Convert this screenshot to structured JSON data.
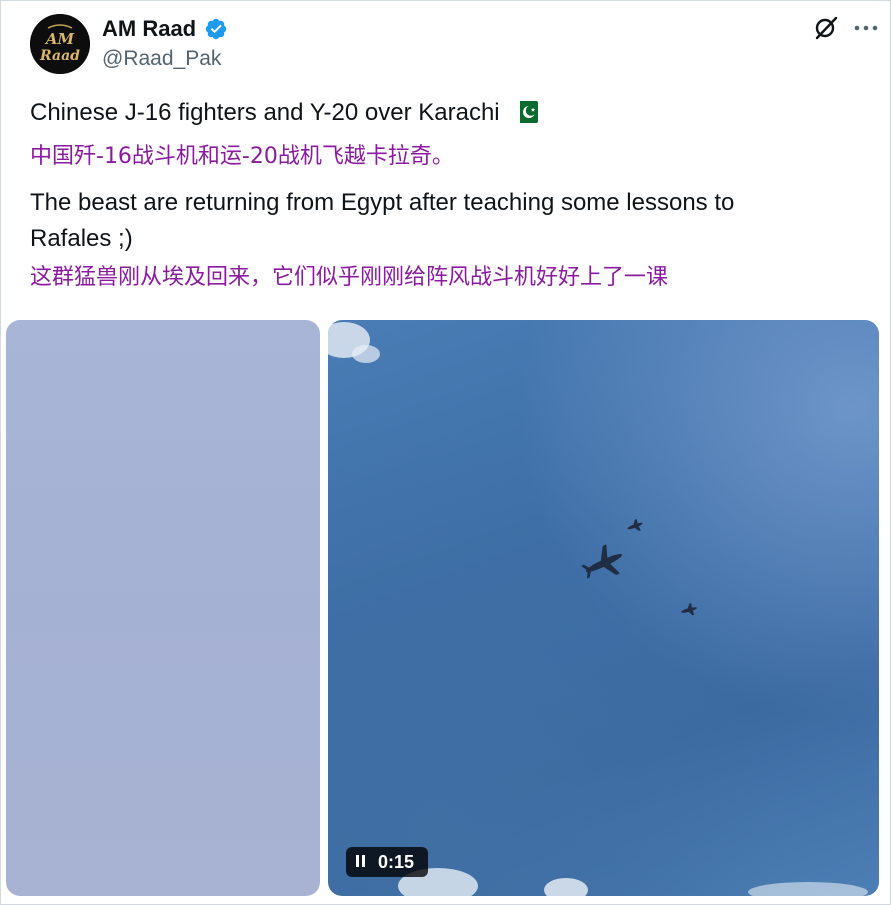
{
  "post": {
    "author": {
      "display_name": "AM Raad",
      "handle": "@Raad_Pak",
      "verified": true,
      "avatar_text": [
        "AM",
        "Raad"
      ]
    },
    "icons": {
      "grok": "grok-icon",
      "more": "more-icon",
      "verified": "verified-badge-icon",
      "flag": "pakistan-flag-icon",
      "pause": "pause-icon"
    },
    "text": {
      "line1": "Chinese J-16 fighters and Y-20 over Karachi",
      "line1_zh": "中国歼-16战斗机和运-20战机飞越卡拉奇。",
      "line2a": "The beast are returning from Egypt after teaching some lessons to",
      "line2b": "Rafales ;)",
      "line2_zh": "这群猛兽刚从埃及回来，它们似乎刚刚给阵风战斗机好好上了一课"
    },
    "media": {
      "video_duration": "0:15"
    }
  },
  "colors": {
    "translation_text": "#8b1aa0",
    "verified_blue": "#1d9bf0",
    "handle_gray": "#536471"
  }
}
